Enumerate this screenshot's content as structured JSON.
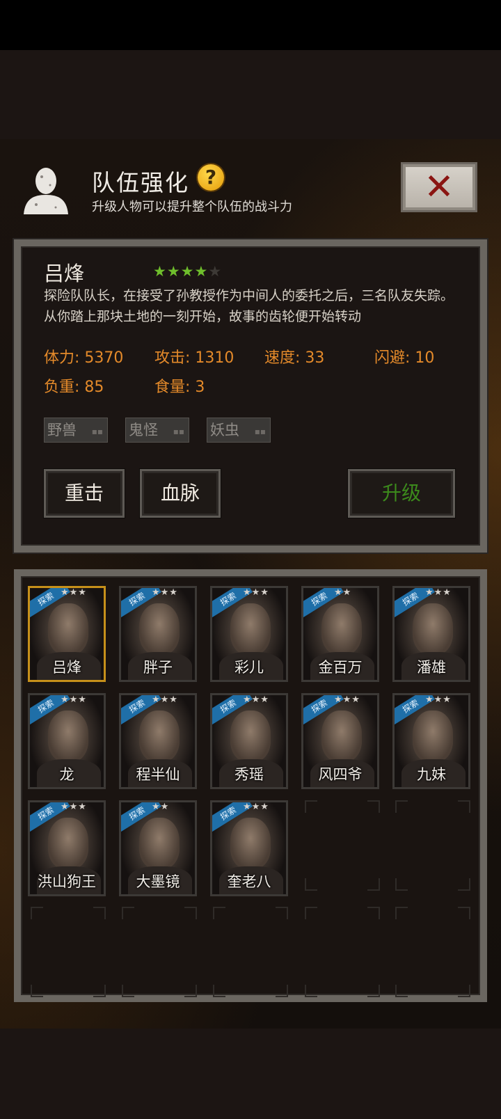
{
  "header": {
    "title": "队伍强化",
    "help": "?",
    "subtitle": "升级人物可以提升整个队伍的战斗力",
    "close": "✕"
  },
  "character": {
    "name": "吕烽",
    "stars": 4,
    "max_stars": 5,
    "description": "探险队队长，在接受了孙教授作为中间人的委托之后，三名队友失踪。从你踏上那块土地的一刻开始，故事的齿轮便开始转动",
    "stats": {
      "stamina": "体力: 5370",
      "attack": "攻击: 1310",
      "speed": "速度: 33",
      "dodge": "闪避: 10",
      "load": "负重: 85",
      "food": "食量: 3"
    },
    "tags": [
      "野兽",
      "鬼怪",
      "妖虫"
    ],
    "tag_dots": "▪▪",
    "buttons": {
      "skill1": "重击",
      "skill2": "血脉",
      "upgrade": "升级"
    }
  },
  "roster": {
    "badge": "探索",
    "members": [
      {
        "name": "吕烽",
        "stars": "★★★"
      },
      {
        "name": "胖子",
        "stars": "★★★"
      },
      {
        "name": "彩儿",
        "stars": "★★★"
      },
      {
        "name": "金百万",
        "stars": "★★"
      },
      {
        "name": "潘雄",
        "stars": "★★★"
      },
      {
        "name": "龙",
        "stars": "★★★"
      },
      {
        "name": "程半仙",
        "stars": "★★★"
      },
      {
        "name": "秀瑶",
        "stars": "★★★"
      },
      {
        "name": "风四爷",
        "stars": "★★★"
      },
      {
        "name": "九妹",
        "stars": "★★★"
      },
      {
        "name": "洪山狗王",
        "stars": "★★★"
      },
      {
        "name": "大墨镜",
        "stars": "★★"
      },
      {
        "name": "奎老八",
        "stars": "★★★"
      }
    ]
  },
  "colors": {
    "accent_orange": "#e48a2a",
    "star_green": "#6fbe2c",
    "upgrade_green": "#3c8a1c",
    "selected_border": "#c6901a",
    "badge_blue": "#1f6fa8"
  }
}
